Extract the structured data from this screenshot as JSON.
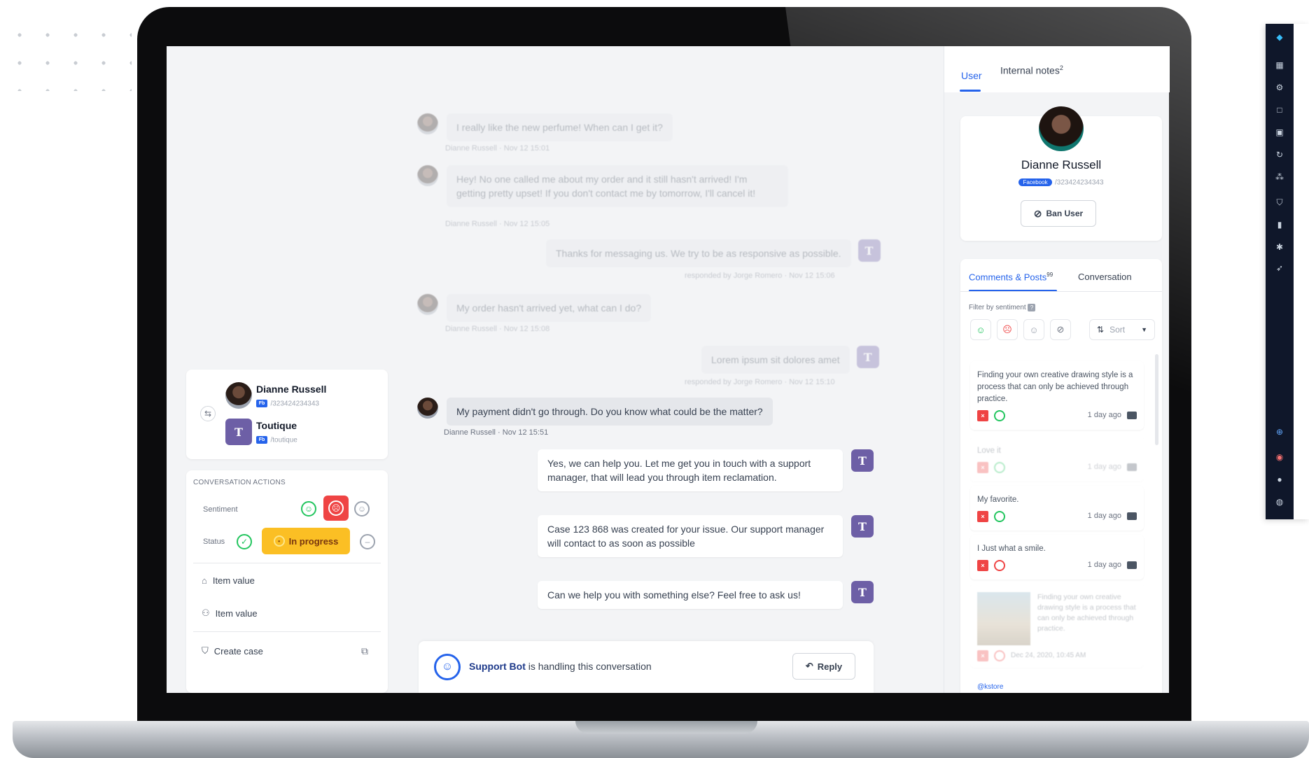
{
  "conversation": {
    "messages_faded": [
      {
        "text": "I really like the new perfume! When can I get it?",
        "meta": "Dianne Russell · Nov 12 15:01"
      },
      {
        "text": "Hey! No one called me about my order and it still hasn't arrived! I'm getting pretty upset! If you don't contact me by tomorrow, I'll cancel it!",
        "meta": "Dianne Russell · Nov 12 15:05"
      },
      {
        "text": "Thanks for messaging us. We try to be as responsive as possible.",
        "meta": "responded by Jorge Romero · Nov 12 15:06"
      },
      {
        "text": "My order hasn't arrived yet, what can I do?",
        "meta": "Dianne Russell · Nov 12 15:08"
      },
      {
        "text": "Lorem ipsum sit dolores amet",
        "meta": "responded by Jorge Romero · Nov 12 15:10"
      }
    ],
    "customer_message": {
      "text": "My payment didn't go through. Do you know what could be the matter?",
      "meta": "Dianne Russell · Nov 12 15:51"
    },
    "agent_messages": [
      {
        "text": "Yes, we can help you. Let me get you in touch with a support manager, that will lead you through item reclamation."
      },
      {
        "text": "Case 123 868 was created for your issue. Our support manager will contact to as soon as possible"
      },
      {
        "text": "Can we help you with something else? Feel free to ask us!"
      }
    ],
    "bot_bar": {
      "bot_name": "Support Bot",
      "suffix": "is handling this conversation",
      "reply_label": "Reply"
    }
  },
  "participants": {
    "customer": {
      "name": "Dianne Russell",
      "platform": "Fb",
      "id": "/323424234343"
    },
    "brand": {
      "name": "Toutique",
      "platform": "Fb",
      "handle": "/toutique",
      "logo": "T"
    }
  },
  "actions": {
    "title": "CONVERSATION ACTIONS",
    "sentiment_label": "Sentiment",
    "status_label": "Status",
    "status_value": "In progress",
    "items": [
      {
        "icon": "tag-icon",
        "label": "Item value"
      },
      {
        "icon": "people-icon",
        "label": "Item value"
      }
    ],
    "create_case": "Create case"
  },
  "right_panel": {
    "tabs": [
      {
        "label": "User",
        "active": true
      },
      {
        "label": "Internal notes",
        "badge": "2",
        "active": false
      }
    ],
    "user": {
      "name": "Dianne Russell",
      "platform": "Facebook",
      "id": "/323424234343",
      "ban_label": "Ban User"
    },
    "sub_tabs": [
      {
        "label": "Comments & Posts",
        "badge": "99",
        "active": true
      },
      {
        "label": "Conversation",
        "active": false
      }
    ],
    "filter_label": "Filter by sentiment",
    "sort_label": "Sort",
    "posts": [
      {
        "text": "Finding your own creative drawing style is a process that can only be achieved through practice.",
        "ago": "1 day ago",
        "faded": false
      },
      {
        "text": "Love it",
        "ago": "1 day ago",
        "faded": true
      },
      {
        "text": "My favorite.",
        "ago": "1 day ago",
        "faded": false
      },
      {
        "text": "I Just what a smile.",
        "ago": "1 day ago",
        "faded": false
      },
      {
        "text": "Finding your own creative drawing style is a process that can only be achieved through practice.",
        "ago": "Dec 24, 2020, 10:45 AM",
        "faded": true
      }
    ],
    "footer_link": "@kstore"
  },
  "colors": {
    "accent": "#2563eb",
    "brand": "#6d5fa6",
    "danger": "#ef4444",
    "warning": "#fbbf24",
    "success": "#22c55e"
  }
}
